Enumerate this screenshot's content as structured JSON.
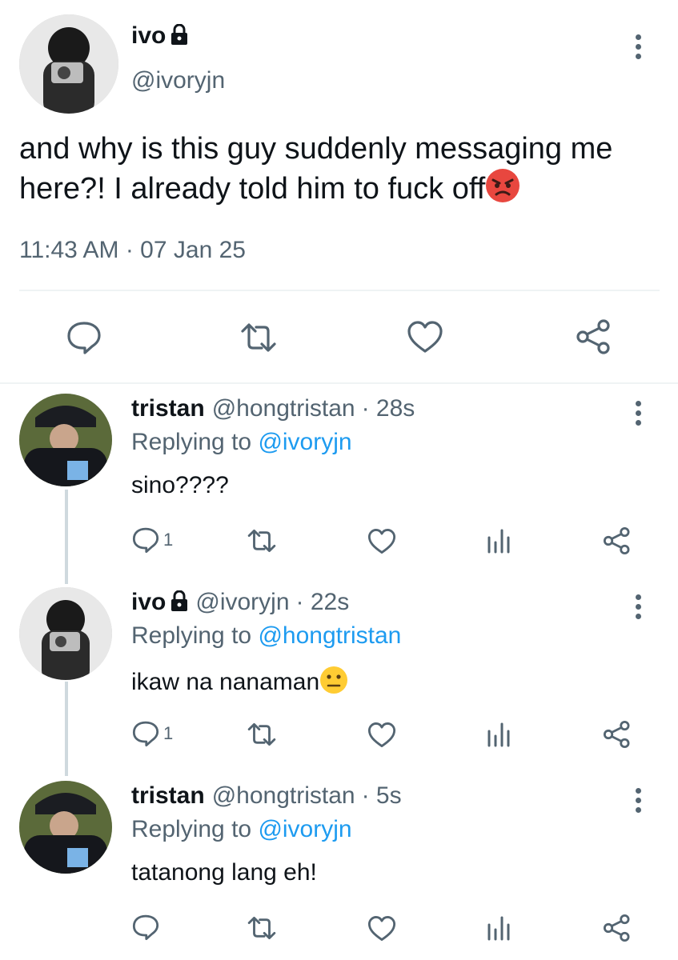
{
  "main_tweet": {
    "display_name": "ivo",
    "handle": "@ivoryjn",
    "text": "and why is this guy suddenly messaging me here?! I already told him to fuck off",
    "emoji": "angry-face",
    "timestamp": "11:43 AM · 07 Jan 25"
  },
  "replies": [
    {
      "display_name": "tristan",
      "handle": "@hongtristan",
      "time": "· 28s",
      "replying_prefix": "Replying to ",
      "replying_to": "@ivoryjn",
      "text": "sino????",
      "reply_count": "1"
    },
    {
      "display_name": "ivo",
      "handle": "@ivoryjn",
      "time": "· 22s",
      "replying_prefix": "Replying to ",
      "replying_to": "@hongtristan",
      "text": "ikaw na nanaman",
      "emoji": "neutral-face",
      "reply_count": "1"
    },
    {
      "display_name": "tristan",
      "handle": "@hongtristan",
      "time": "· 5s",
      "replying_prefix": "Replying to ",
      "replying_to": "@ivoryjn",
      "text": "tatanong lang eh!",
      "reply_count": ""
    }
  ],
  "colors": {
    "accent": "#1d9bf0",
    "secondary_text": "#536471",
    "divider": "#eff3f4"
  }
}
